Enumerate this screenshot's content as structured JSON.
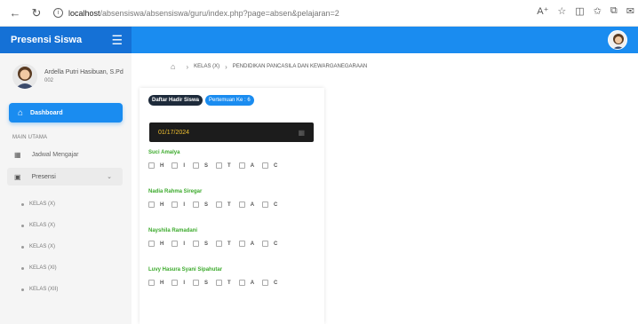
{
  "browser": {
    "url_host": "localhost",
    "url_path": "/absensiswa/absensiswa/guru/index.php?page=absen&pelajaran=2"
  },
  "app": {
    "brand": "Presensi Siswa"
  },
  "profile": {
    "name": "Ardella Putri Hasibuan, S.Pd",
    "code": "002"
  },
  "sidebar": {
    "dashboard_label": "Dashboard",
    "section_label": "MAIN UTAMA",
    "jadwal_label": "Jadwal Mengajar",
    "presensi_label": "Presensi",
    "sub_items": [
      "KELAS (X)",
      "KELAS (X)",
      "KELAS (X)",
      "KELAS (XI)",
      "KELAS (XII)"
    ]
  },
  "breadcrumb": {
    "kelas": "KELAS (X)",
    "subject": "PENDIDIKAN PANCASILA DAN KEWARGANEGARAAN"
  },
  "attendance": {
    "title_badge": "Daftar Hadir Siswa",
    "meeting_badge": "Pertemuan Ke : 6",
    "date_value": "01/17/2024",
    "options": [
      "H",
      "I",
      "S",
      "T",
      "A",
      "C"
    ],
    "students": [
      "Suci Amalya",
      "Nadia Rahma Siregar",
      "Nayshila Ramadani",
      "Luvy Hasura Syani Sipahutar"
    ]
  }
}
